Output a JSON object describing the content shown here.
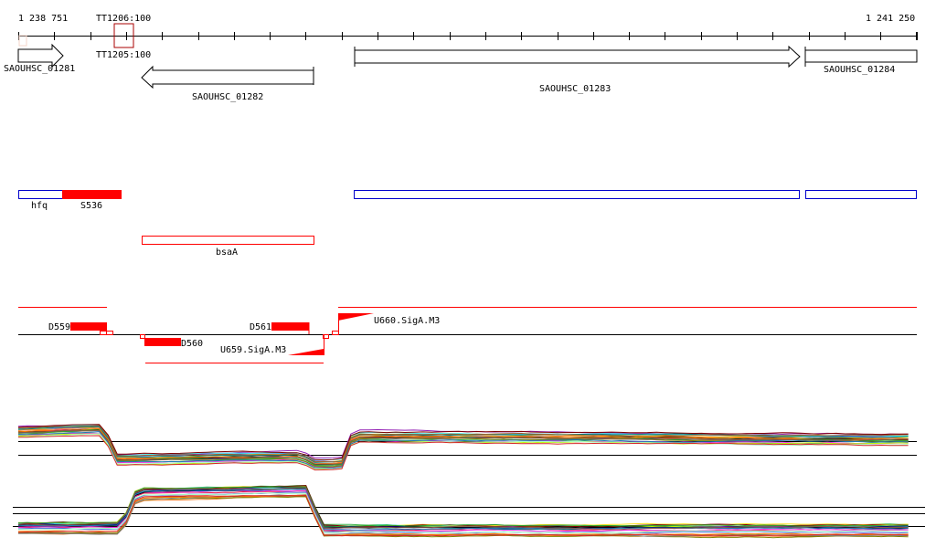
{
  "ruler": {
    "start_label": "1 238 751",
    "end_label": "1 241 250",
    "start": 1238751,
    "end": 1241250
  },
  "terminators": {
    "top_label": "TT1206:100",
    "bottom_label": "TT1205:100"
  },
  "genes": [
    {
      "name": "SAOUHSC_01281",
      "from": 1238751,
      "to": 1238873,
      "strand": "+"
    },
    {
      "name": "SAOUHSC_01282",
      "from": 1239094,
      "to": 1239573,
      "strand": "-"
    },
    {
      "name": "SAOUHSC_01283",
      "from": 1239687,
      "to": 1240930,
      "strand": "+"
    },
    {
      "name": "SAOUHSC_01284",
      "from": 1240945,
      "to": 1241250,
      "strand": "+"
    }
  ],
  "features": {
    "hfq": "hfq",
    "s536": "S536",
    "bsaA": "bsaA"
  },
  "segments": {
    "d559": "D559",
    "d560": "D560",
    "d561": "D561",
    "u659": "U659.SigA.M3",
    "u660": "U660.SigA.M3"
  },
  "colors": {
    "red": "#ff0000",
    "blue": "#0000cc",
    "dark_red": "#aa0000"
  },
  "coverage_tracks": [
    {
      "name": "track-1",
      "profile": [
        [
          1238751,
          0.2
        ],
        [
          1238990,
          0.15
        ],
        [
          1239020,
          0.75
        ],
        [
          1239540,
          0.7
        ],
        [
          1239570,
          0.85
        ],
        [
          1239650,
          0.85
        ],
        [
          1239680,
          0.3
        ],
        [
          1241250,
          0.35
        ]
      ]
    },
    {
      "name": "track-2",
      "profile": [
        [
          1238751,
          0.75
        ],
        [
          1239040,
          0.75
        ],
        [
          1239080,
          0.15
        ],
        [
          1239560,
          0.1
        ],
        [
          1239590,
          0.8
        ],
        [
          1241250,
          0.8
        ]
      ]
    }
  ]
}
